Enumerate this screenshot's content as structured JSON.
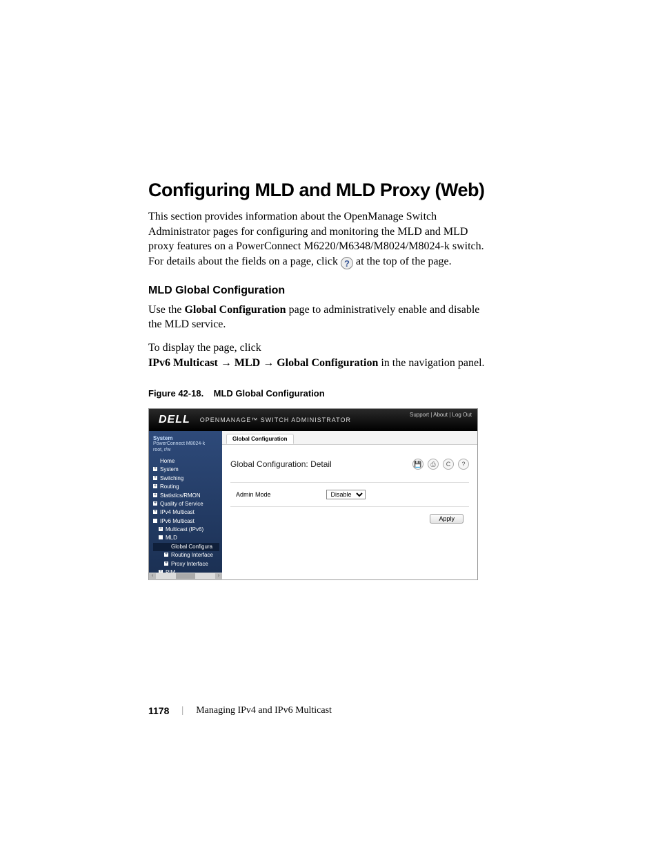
{
  "heading": "Configuring MLD and MLD Proxy (Web)",
  "intro_before": "This section provides information about the OpenManage Switch Administrator pages for configuring and monitoring the MLD and MLD proxy features on a PowerConnect M6220/M6348/M8024/M8024-k switch. For details about the fields on a page, click ",
  "intro_after": " at the top of the page.",
  "subheading": "MLD Global Configuration",
  "p1_a": "Use the ",
  "p1_b": "Global Configuration",
  "p1_c": " page to administratively enable and disable the MLD service.",
  "p2_a": "To display the page, click ",
  "p2_b": "IPv6 Multicast",
  "p2_c": " → ",
  "p2_d": "MLD",
  "p2_e": " → ",
  "p2_f": "Global Configuration",
  "p2_g": " in the navigation panel.",
  "figure_caption_a": "Figure 42-18.",
  "figure_caption_b": "MLD Global Configuration",
  "shot": {
    "logo": "DELL",
    "app_title": "OPENMANAGE™ SWITCH ADMINISTRATOR",
    "header_links": "Support  |  About  |  Log Out",
    "sidebar": {
      "system": "System",
      "model": "PowerConnect M8024-k",
      "user": "root, r/w",
      "items": [
        "Home",
        "System",
        "Switching",
        "Routing",
        "Statistics/RMON",
        "Quality of Service",
        "IPv4 Multicast",
        "IPv6 Multicast",
        "Multicast (IPv6)",
        "MLD",
        "Global Configura",
        "Routing Interface",
        "Proxy Interface",
        "PIM"
      ]
    },
    "tab": "Global Configuration",
    "panel_title": "Global Configuration: Detail",
    "field_label": "Admin Mode",
    "field_value": "Disable",
    "apply": "Apply"
  },
  "footer": {
    "page": "1178",
    "chapter": "Managing IPv4 and IPv6 Multicast"
  }
}
